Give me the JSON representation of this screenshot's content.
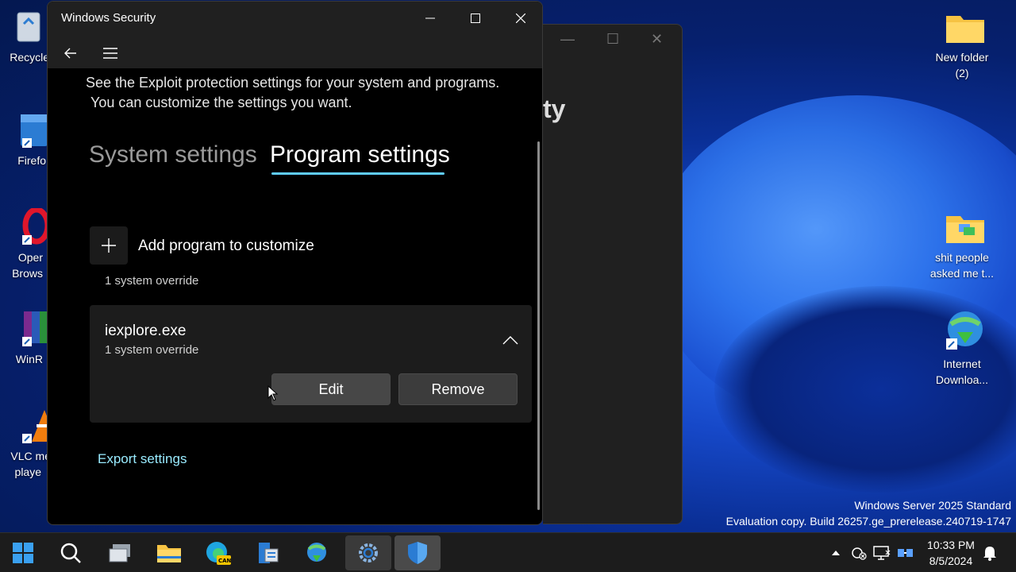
{
  "window": {
    "title": "Windows Security",
    "intro_line1": "See the Exploit protection settings for your system and programs.",
    "intro_line2": "You can customize the settings you want.",
    "tabs": [
      "System settings",
      "Program settings"
    ],
    "active_tab": "Program settings",
    "add_program_label": "Add program to customize",
    "system_override_text": "1 system override",
    "program": {
      "name": "iexplore.exe",
      "subtitle": "1 system override"
    },
    "edit_button": "Edit",
    "remove_button": "Remove",
    "export_link": "Export settings"
  },
  "background_window": {
    "title_fragment": "ty"
  },
  "desktop_icons": {
    "recycle": "Recycle",
    "firefox": "Firefo",
    "opera_1": "Oper",
    "opera_2": "Brows",
    "winrar": "WinR",
    "vlc_1": "VLC me",
    "vlc_2": "playe",
    "new_folder_1": "New folder",
    "new_folder_2": "(2)",
    "shit_1": "shit people",
    "shit_2": "asked me t...",
    "idm_1": "Internet",
    "idm_2": "Downloa..."
  },
  "watermark": {
    "line1": "Windows Server 2025 Standard",
    "line2": "Evaluation copy. Build 26257.ge_prerelease.240719-1747"
  },
  "taskbar": {
    "time": "10:33 PM",
    "date": "8/5/2024",
    "apps": [
      "start-icon",
      "search-icon",
      "task-view-icon",
      "file-explorer-icon",
      "edge-icon",
      "server-manager-icon",
      "idm-icon",
      "settings-icon",
      "windows-security-icon"
    ]
  },
  "colors": {
    "accent": "#60cdff",
    "link": "#99ebff",
    "window_bg": "#000000",
    "titlebar_bg": "#202020"
  }
}
